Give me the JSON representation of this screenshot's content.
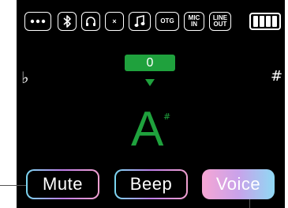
{
  "status_bar": {
    "icons": [
      {
        "name": "menu-dots-icon"
      },
      {
        "name": "bluetooth-icon"
      },
      {
        "name": "headphones-icon"
      },
      {
        "name": "close-icon",
        "glyph": "×"
      },
      {
        "name": "music-note-icon"
      },
      {
        "name": "otg-icon",
        "label": "OTG"
      },
      {
        "name": "mic-in-icon",
        "label_line1": "MIC",
        "label_line2": "IN"
      },
      {
        "name": "line-out-icon",
        "label_line1": "LINE",
        "label_line2": "OUT"
      },
      {
        "name": "battery-icon",
        "cells": 4
      }
    ]
  },
  "tuner": {
    "cents_value": "0",
    "flat_symbol": "♭",
    "sharp_symbol": "#",
    "note": "A",
    "note_accidental": "#"
  },
  "buttons": {
    "mute_label": "Mute",
    "beep_label": "Beep",
    "voice_label": "Voice"
  },
  "colors": {
    "background": "#000000",
    "tuner_green": "#1fa13d",
    "text": "#ffffff",
    "gradient": [
      "#f6a6d4",
      "#c9a2ea",
      "#8fd9f4"
    ]
  }
}
